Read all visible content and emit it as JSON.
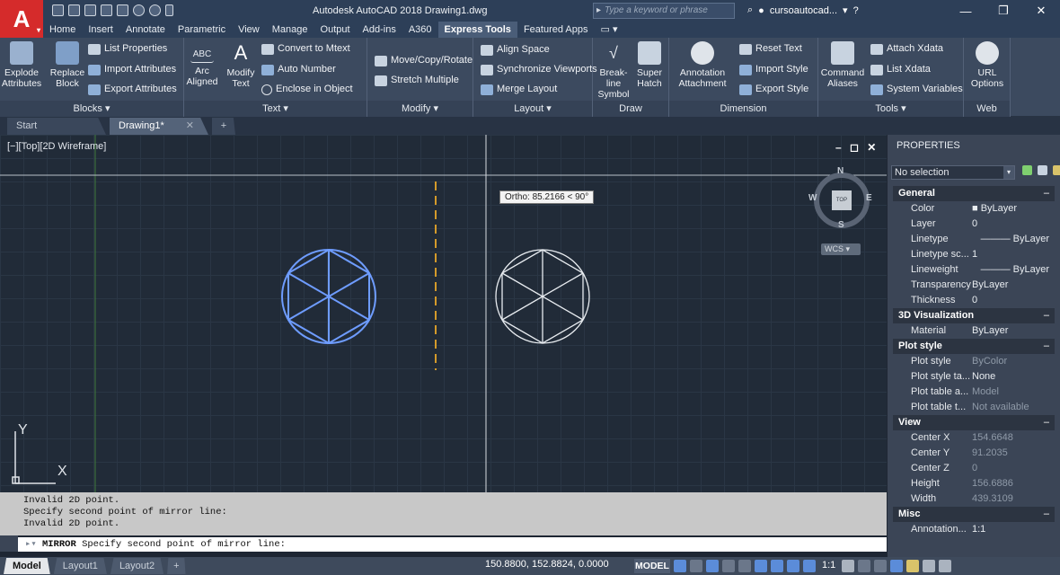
{
  "app": {
    "title": "Autodesk AutoCAD 2018   Drawing1.dwg",
    "logo": "A",
    "search_placeholder": "Type a keyword or phrase",
    "user": "cursoautocad...",
    "accent": "#d52b2b"
  },
  "ribbon_tabs": [
    "Home",
    "Insert",
    "Annotate",
    "Parametric",
    "View",
    "Manage",
    "Output",
    "Add-ins",
    "A360",
    "Express Tools",
    "Featured Apps"
  ],
  "ribbon_active_tab": "Express Tools",
  "ribbon": {
    "blocks": {
      "label": "Blocks ▾",
      "explode": "Explode Attributes",
      "replace": "Replace Block",
      "list_props": "List Properties",
      "import_attrs": "Import Attributes",
      "export_attrs": "Export Attributes"
    },
    "text": {
      "label": "Text ▾",
      "arc_aligned": "Arc Aligned",
      "modify_text": "Modify Text",
      "convert_mtext": "Convert to Mtext",
      "auto_number": "Auto Number",
      "enclose": "Enclose in Object"
    },
    "modify": {
      "label": "Modify ▾",
      "move_copy_rotate": "Move/Copy/Rotate",
      "stretch_multiple": "Stretch Multiple"
    },
    "layout": {
      "label": "Layout ▾",
      "align_space": "Align Space",
      "sync_viewports": "Synchronize Viewports",
      "merge_layout": "Merge Layout"
    },
    "draw": {
      "label": "Draw",
      "breakline": "Break-line Symbol",
      "super_hatch": "Super Hatch"
    },
    "dimension": {
      "label": "Dimension",
      "annotation_attachment": "Annotation Attachment",
      "reset_text": "Reset Text",
      "import_style": "Import Style",
      "export_style": "Export Style"
    },
    "tools": {
      "label": "Tools ▾",
      "command_aliases": "Command Aliases",
      "attach_xdata": "Attach Xdata",
      "list_xdata": "List Xdata",
      "system_variables": "System Variables"
    },
    "web": {
      "label": "Web",
      "url_options": "URL Options"
    }
  },
  "doc_tabs": [
    "Start",
    "Drawing1*"
  ],
  "viewport": {
    "label": "[−][Top][2D Wireframe]",
    "tooltip": "Ortho: 85.2166 < 90°",
    "viewcube_face": "TOP",
    "compass": {
      "n": "N",
      "s": "S",
      "e": "E",
      "w": "W"
    },
    "wcs": "WCS ▾",
    "y_axis": "Y",
    "x_axis": "X",
    "controls": "– ◻ ✕"
  },
  "properties": {
    "title": "PROPERTIES",
    "selection": "No selection",
    "sections": [
      {
        "name": "General",
        "rows": [
          {
            "k": "Color",
            "v": "■ ByLayer"
          },
          {
            "k": "Layer",
            "v": "0"
          },
          {
            "k": "Linetype",
            "v": "——— ByLayer"
          },
          {
            "k": "Linetype sc...",
            "v": "1"
          },
          {
            "k": "Lineweight",
            "v": "——— ByLayer"
          },
          {
            "k": "Transparency",
            "v": "ByLayer"
          },
          {
            "k": "Thickness",
            "v": "0"
          }
        ]
      },
      {
        "name": "3D Visualization",
        "rows": [
          {
            "k": "Material",
            "v": "ByLayer"
          }
        ]
      },
      {
        "name": "Plot style",
        "rows": [
          {
            "k": "Plot style",
            "v": "ByColor"
          },
          {
            "k": "Plot style ta...",
            "v": "None"
          },
          {
            "k": "Plot table a...",
            "v": "Model"
          },
          {
            "k": "Plot table t...",
            "v": "Not available"
          }
        ]
      },
      {
        "name": "View",
        "rows": [
          {
            "k": "Center X",
            "v": "154.6648"
          },
          {
            "k": "Center Y",
            "v": "91.2035"
          },
          {
            "k": "Center Z",
            "v": "0"
          },
          {
            "k": "Height",
            "v": "156.6886"
          },
          {
            "k": "Width",
            "v": "439.3109"
          }
        ]
      },
      {
        "name": "Misc",
        "rows": [
          {
            "k": "Annotation...",
            "v": "1:1"
          }
        ]
      }
    ]
  },
  "command": {
    "history": [
      "Invalid 2D point.",
      "Specify second point of mirror line:",
      "Invalid 2D point."
    ],
    "prompt_cmd": "MIRROR",
    "prompt_text": "Specify second point of mirror line:"
  },
  "status": {
    "layout_tabs": [
      "Model",
      "Layout1",
      "Layout2"
    ],
    "coords": "150.8800, 152.8824, 0.0000",
    "model": "MODEL",
    "scale": "1:1"
  }
}
